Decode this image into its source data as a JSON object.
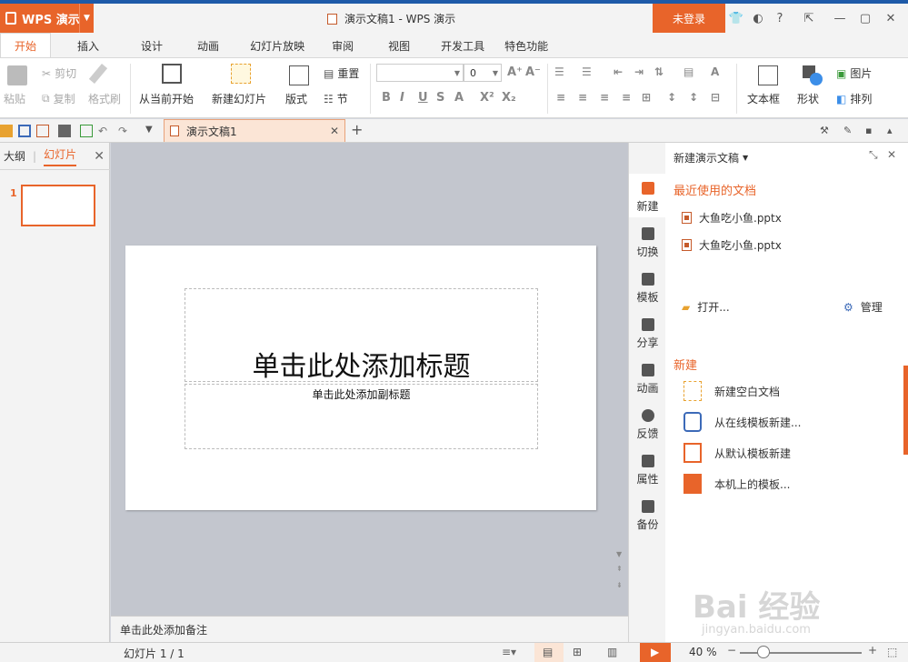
{
  "app": {
    "name": "WPS 演示",
    "doc_title": "演示文稿1 - WPS 演示",
    "login": "未登录"
  },
  "ribbon_tabs": [
    "开始",
    "插入",
    "设计",
    "动画",
    "幻灯片放映",
    "审阅",
    "视图",
    "开发工具",
    "特色功能"
  ],
  "ribbon": {
    "paste": "粘贴",
    "cut": "剪切",
    "copy": "复制",
    "format_painter": "格式刷",
    "from_start": "从当前开始",
    "new_slide": "新建幻灯片",
    "layout": "版式",
    "reset": "重置",
    "section": "节",
    "font_size": "0",
    "text_box": "文本框",
    "shape": "形状",
    "picture": "图片",
    "arrange": "排列"
  },
  "doc_tab": {
    "title": "演示文稿1"
  },
  "left_panel": {
    "tab_outline": "大纲",
    "tab_slides": "幻灯片",
    "slide_number": "1"
  },
  "slide": {
    "title_placeholder": "单击此处添加标题",
    "subtitle_placeholder": "单击此处添加副标题"
  },
  "notes_placeholder": "单击此处添加备注",
  "sidebar": [
    "新建",
    "切换",
    "模板",
    "分享",
    "动画",
    "反馈",
    "属性",
    "备份"
  ],
  "task_pane": {
    "header": "新建演示文稿",
    "recent_heading": "最近使用的文档",
    "recent": [
      "大鱼吃小鱼.pptx",
      "大鱼吃小鱼.pptx"
    ],
    "open": "打开...",
    "manage": "管理",
    "new_heading": "新建",
    "new_items": [
      "新建空白文档",
      "从在线模板新建...",
      "从默认模板新建",
      "本机上的模板..."
    ]
  },
  "status": {
    "slide_info": "幻灯片 1 / 1",
    "zoom": "40 %"
  },
  "watermark": {
    "brand": "Bai 经验",
    "url": "jingyan.baidu.com"
  },
  "colors": {
    "accent": "#e8642a",
    "titlebar_top": "#1e5aa8"
  }
}
